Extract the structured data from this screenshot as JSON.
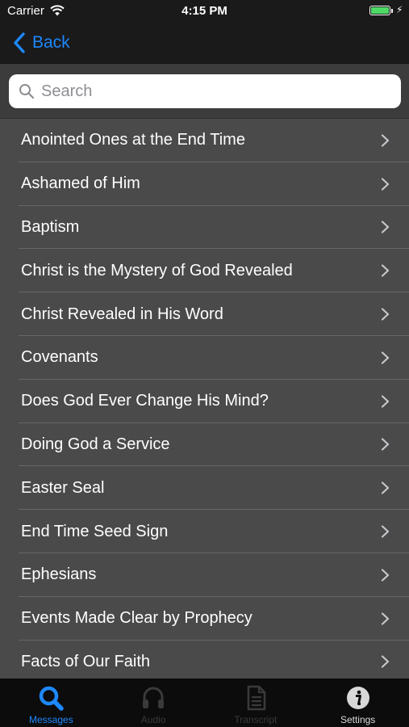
{
  "status": {
    "carrier": "Carrier",
    "time": "4:15 PM",
    "battery_level": 1.0
  },
  "nav": {
    "back_label": "Back"
  },
  "search": {
    "placeholder": "Search",
    "value": ""
  },
  "list_items": [
    "Anointed Ones at the End Time",
    "Ashamed of Him",
    "Baptism",
    "Christ is the Mystery of God Revealed",
    "Christ Revealed in His Word",
    "Covenants",
    "Does God Ever Change His Mind?",
    "Doing God a Service",
    "Easter Seal",
    "End Time Seed Sign",
    "Ephesians",
    "Events Made Clear by Prophecy",
    "Facts of Our Faith"
  ],
  "tabs": [
    {
      "name": "messages",
      "label": "Messages",
      "icon": "magnifier-icon",
      "state": "active"
    },
    {
      "name": "audio",
      "label": "Audio",
      "icon": "headphones-icon",
      "state": "disabled"
    },
    {
      "name": "transcript",
      "label": "Transcript",
      "icon": "document-icon",
      "state": "disabled"
    },
    {
      "name": "settings",
      "label": "Settings",
      "icon": "info-icon",
      "state": "normal"
    }
  ],
  "colors": {
    "accent": "#1e88ff",
    "list_background": "#4a4a4a",
    "bar_background": "#1a1a1a",
    "tab_bar_background": "#0c0c0c",
    "tab_disabled": "#3a3a3a",
    "tab_normal": "#d8d8d8",
    "battery": "#4cd964"
  }
}
